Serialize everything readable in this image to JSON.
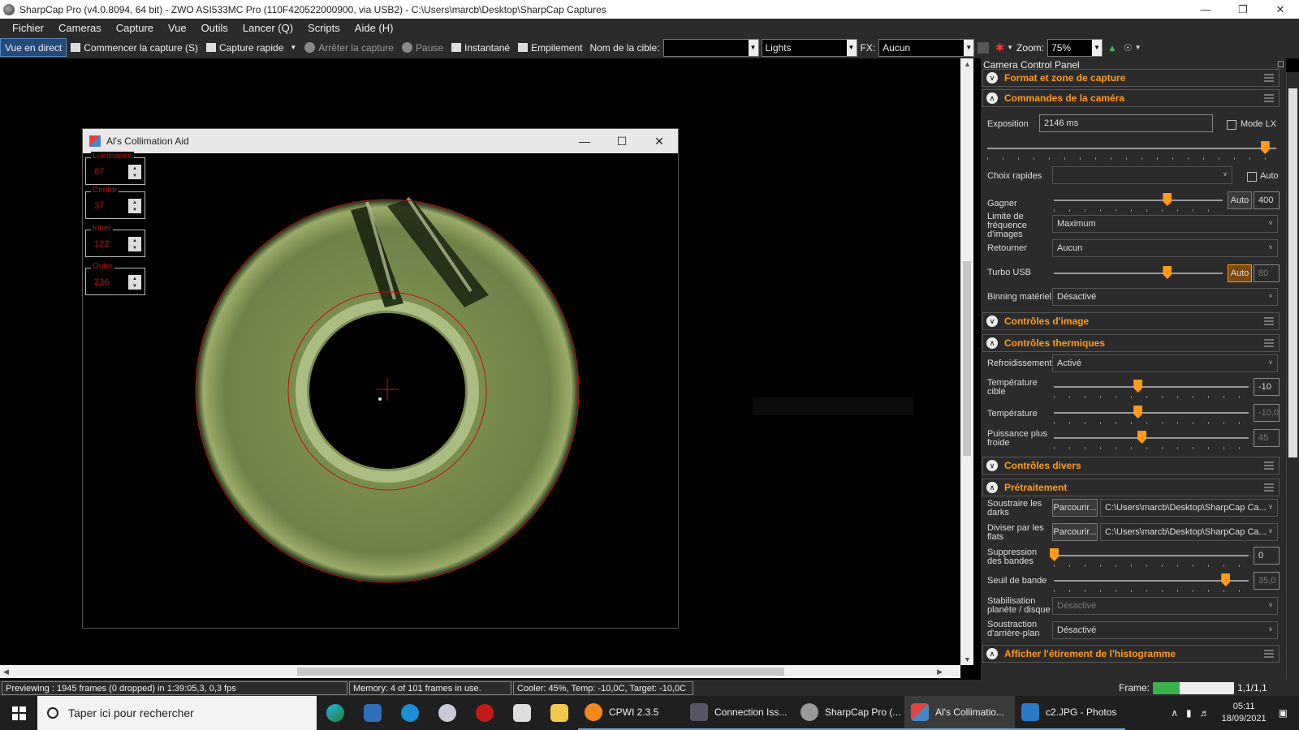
{
  "window": {
    "title": "SharpCap Pro (v4.0.8094, 64 bit) - ZWO ASI533MC Pro (110F420522000900, via USB2) - C:\\Users\\marcb\\Desktop\\SharpCap Captures"
  },
  "menu": [
    "Fichier",
    "Cameras",
    "Capture",
    "Vue",
    "Outils",
    "Lancer (Q)",
    "Scripts",
    "Aide (H)"
  ],
  "toolbar": {
    "live_view": "Vue en direct",
    "start_capture": "Commencer la capture (S)",
    "quick_capture": "Capture rapide",
    "stop_capture": "Arrêter la capture",
    "pause": "Pause",
    "snapshot": "Instantané",
    "stacking": "Empilement",
    "target_label": "Nom de la cible:",
    "target_value": "",
    "frame_type": "Lights",
    "fx_label": "FX:",
    "fx_value": "Aucun",
    "zoom_label": "Zoom:",
    "zoom_value": "75%"
  },
  "collimation": {
    "title": "Al's Collimation Aid",
    "fields": [
      {
        "label": "Luminance",
        "value": "67"
      },
      {
        "label": "Centre",
        "value": "37"
      },
      {
        "label": "Inner",
        "value": "122"
      },
      {
        "label": "Outer",
        "value": "236"
      }
    ]
  },
  "panel": {
    "title": "Camera Control Panel",
    "sections": {
      "format": "Format et zone de capture",
      "camera": "Commandes de la caméra",
      "image": "Contrôles d'image",
      "thermal": "Contrôles thermiques",
      "misc": "Contrôles divers",
      "preproc": "Prétraitement",
      "histogram": "Afficher l'étirement de l'histogramme"
    },
    "exposure": {
      "label": "Exposition",
      "value": "2146 ms",
      "lx_label": "Mode LX",
      "level": 0.96
    },
    "quick_choice": {
      "label": "Choix rapides",
      "value": "",
      "auto_label": "Auto"
    },
    "gain": {
      "label": "Gagner",
      "auto": "Auto",
      "value": "400",
      "level": 0.67
    },
    "frame_rate": {
      "label": "Limite de fréquence d'images",
      "value": "Maximum"
    },
    "flip": {
      "label": "Retourner",
      "value": "Aucun"
    },
    "usb_turbo": {
      "label": "Turbo USB",
      "auto": "Auto",
      "value": "80",
      "level": 0.67
    },
    "binning": {
      "label": "Binning matériel",
      "value": "Désactivé"
    },
    "cooling": {
      "label": "Refroidissement",
      "value": "Activé"
    },
    "target_temp": {
      "label": "Température cible",
      "value": "-10",
      "level": 0.43
    },
    "temperature": {
      "label": "Température",
      "value": "-10,0",
      "level": 0.43
    },
    "cooler_power": {
      "label": "Puissance plus froide",
      "value": "45",
      "level": 0.45
    },
    "darks": {
      "label": "Soustraire les darks",
      "browse": "Parcourir...",
      "path": "C:\\Users\\marcb\\Desktop\\SharpCap Ca..."
    },
    "flats": {
      "label": "Diviser par les flats",
      "browse": "Parcourir...",
      "path": "C:\\Users\\marcb\\Desktop\\SharpCap Ca..."
    },
    "banding_supp": {
      "label": "Suppression des bandes",
      "value": "0",
      "level": 0.0
    },
    "banding_thresh": {
      "label": "Seuil de bande",
      "value": "35,0",
      "level": 0.88
    },
    "stabilization": {
      "label": "Stabilisation planète / disque",
      "value": "Désactivé"
    },
    "background_sub": {
      "label": "Soustraction d'arrière-plan",
      "value": "Désactivé"
    }
  },
  "status": {
    "preview": "Previewing : 1945 frames (0 dropped) in 1:39:05,3, 0,3 fps",
    "memory": "Memory: 4 of 101 frames in use.",
    "cooler": "Cooler: 45%, Temp: -10,0C, Target: -10,0C",
    "frame_label": "Frame:",
    "frame_count": "1,1/1,1",
    "frame_level": 0.33
  },
  "taskbar": {
    "search_placeholder": "Taper ici pour rechercher",
    "tasks": [
      "CPWI 2.3.5",
      "Connection Iss...",
      "SharpCap Pro (...",
      "Al's Collimatio...",
      "c2.JPG - Photos"
    ],
    "time": "05:11",
    "date": "18/09/2021"
  },
  "colors": {
    "accent": "#ff9a1a",
    "overlay_red": "#c01010",
    "panel_bg": "#2b2b2b"
  }
}
